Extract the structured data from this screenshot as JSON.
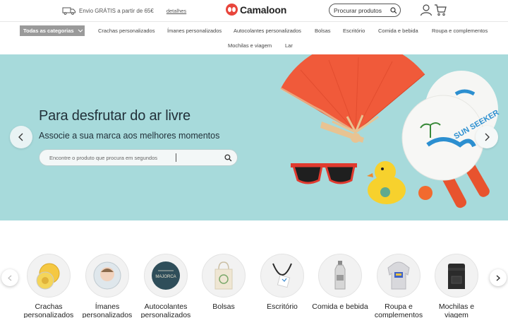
{
  "topbar": {
    "shipping_text": "Envio GRÁTIS a partir de 65€",
    "details_link": "detalhes",
    "brand": "Camaloon",
    "search_placeholder": "Procurar produtos"
  },
  "nav": {
    "all_categories": "Todas as categorias",
    "links": [
      "Crachas personalizados",
      "Ímanes personalizados",
      "Autocolantes personalizados",
      "Bolsas",
      "Escritório",
      "Comida e bebida",
      "Roupa e complementos",
      "Mochilas e viagem",
      "Lar"
    ]
  },
  "hero": {
    "title": "Para desfrutar do ar livre",
    "subtitle": "Associe a sua marca aos melhores momentos",
    "search_placeholder": "Encontre o produto que procura em segundos",
    "paddle_text": "SUN SEEKER"
  },
  "categories": [
    {
      "label": "Crachas personalizados",
      "icon": "badge-icon"
    },
    {
      "label": "Ímanes personalizados",
      "icon": "magnet-icon"
    },
    {
      "label": "Autocolantes personalizados",
      "icon": "sticker-icon",
      "sticker_text": "MAJORCA"
    },
    {
      "label": "Bolsas",
      "icon": "tote-bag-icon"
    },
    {
      "label": "Escritório",
      "icon": "lanyard-icon"
    },
    {
      "label": "Comida e bebida",
      "icon": "bottle-icon"
    },
    {
      "label": "Roupa e complementos",
      "icon": "hoodie-icon"
    },
    {
      "label": "Mochilas e viagem",
      "icon": "backpack-icon"
    }
  ],
  "colors": {
    "hero_bg": "#a7dadb",
    "brand_red": "#e8453c",
    "nav_button": "#9a9a9a"
  }
}
